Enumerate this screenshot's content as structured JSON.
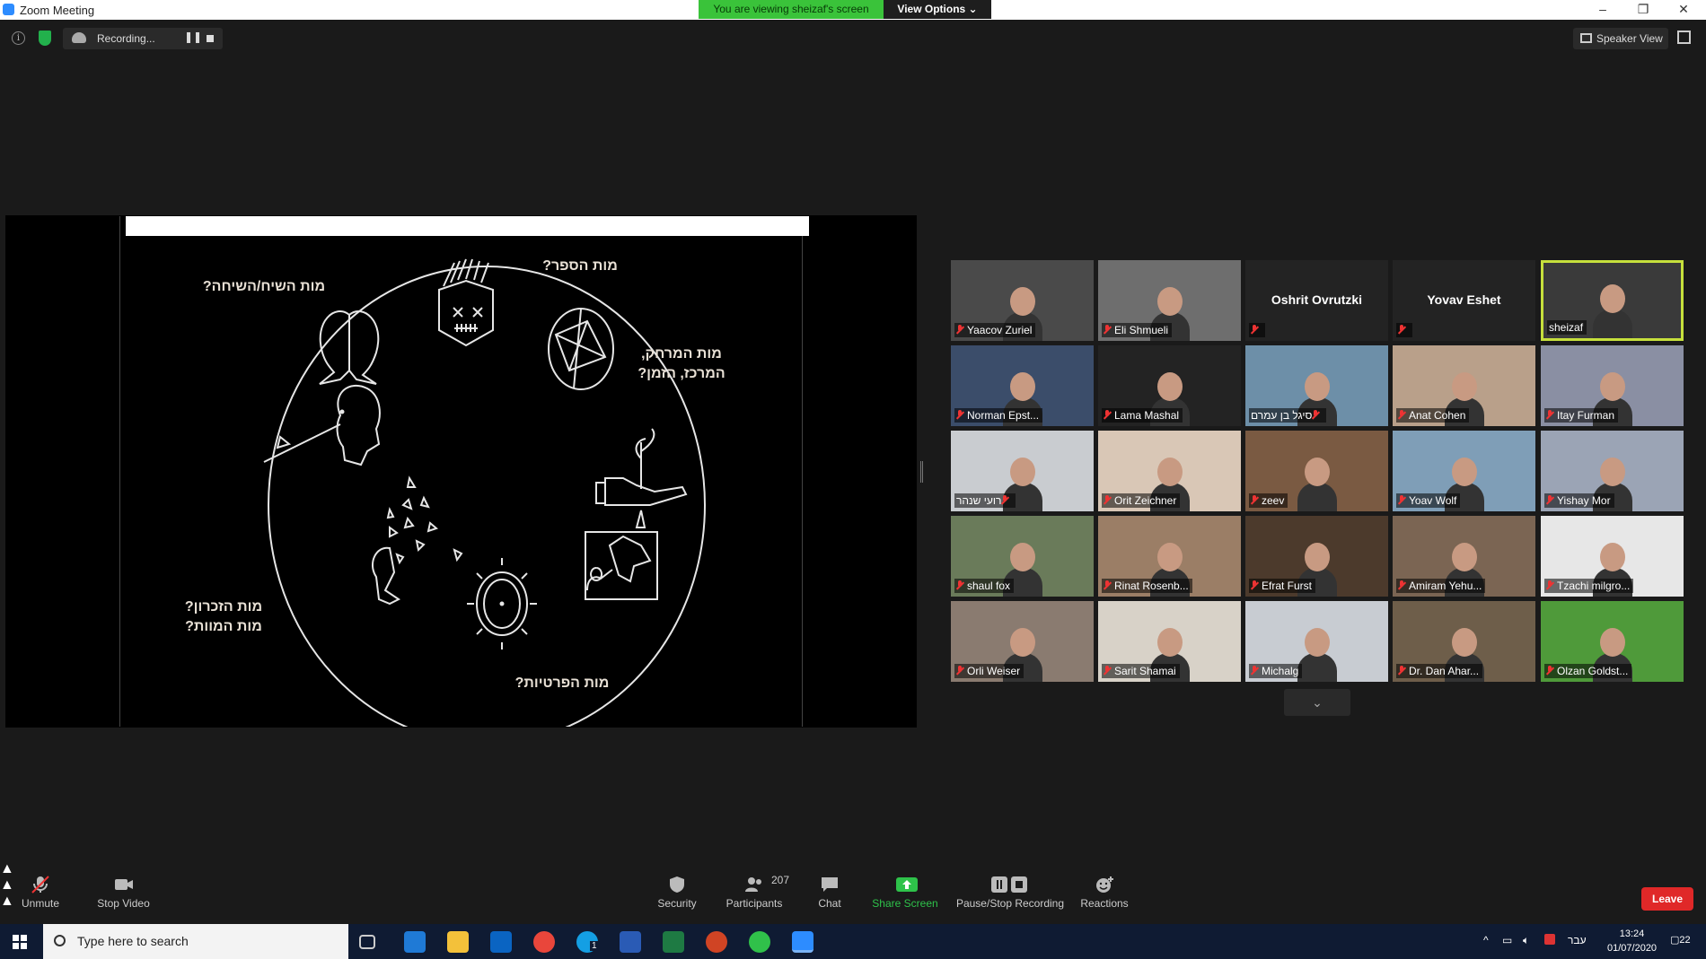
{
  "window": {
    "title": "Zoom Meeting",
    "viewing_banner": "You are viewing sheizaf's screen",
    "view_options": "View Options ⌄"
  },
  "recording": {
    "label": "Recording..."
  },
  "view_mode": "Speaker View",
  "slide": {
    "labels": [
      "מות הספר?",
      "מות השיח/השיחה?",
      "מות המרחק,\nהמרכז, הזמן?",
      "מות הזכרון?\nמות המוות?",
      "מות הפרטיות?"
    ]
  },
  "participants": [
    {
      "name": "Yaacov Zuriel",
      "muted": true
    },
    {
      "name": "Eli Shmueli",
      "muted": true
    },
    {
      "name": "",
      "display_name": "Oshrit Ovrutzki",
      "muted": true
    },
    {
      "name": "",
      "display_name": "Yovav Eshet",
      "muted": true
    },
    {
      "name": "sheizaf",
      "muted": false,
      "active_speaker": true
    },
    {
      "name": "Norman Epst...",
      "muted": true
    },
    {
      "name": "Lama Mashal",
      "muted": true
    },
    {
      "name": "סיגל בן עמרם",
      "muted": true
    },
    {
      "name": "Anat Cohen",
      "muted": true
    },
    {
      "name": "Itay Furman",
      "muted": true
    },
    {
      "name": "רועי שנהר",
      "muted": true
    },
    {
      "name": "Orit Zeichner",
      "muted": true
    },
    {
      "name": "zeev",
      "muted": true
    },
    {
      "name": "Yoav Wolf",
      "muted": true
    },
    {
      "name": "Yishay Mor",
      "muted": true
    },
    {
      "name": "shaul fox",
      "muted": true
    },
    {
      "name": "Rinat Rosenb...",
      "muted": true
    },
    {
      "name": "Efrat Furst",
      "muted": true
    },
    {
      "name": "Amiram Yehu...",
      "muted": true
    },
    {
      "name": "Tzachi milgro...",
      "muted": true
    },
    {
      "name": "Orli Weiser",
      "muted": true
    },
    {
      "name": "Sarit Shamai",
      "muted": true
    },
    {
      "name": "Michalg",
      "muted": true
    },
    {
      "name": "Dr. Dan Ahar...",
      "muted": true
    },
    {
      "name": "Olzan Goldst...",
      "muted": true
    }
  ],
  "toolbar": {
    "unmute": "Unmute",
    "stop_video": "Stop Video",
    "security": "Security",
    "participants": "Participants",
    "participants_count": "207",
    "chat": "Chat",
    "share_screen": "Share Screen",
    "pause_stop_recording": "Pause/Stop Recording",
    "reactions": "Reactions",
    "leave": "Leave"
  },
  "taskbar": {
    "search_placeholder": "Type here to search",
    "language": "עבר",
    "time": "13:24",
    "date": "01/07/2020",
    "notifications": "22",
    "skype_badge": "1"
  },
  "colors": {
    "banner_green": "#3ac33a",
    "leave_red": "#e02828",
    "active_speaker_border": "#c6e03c",
    "taskbar": "#0f1b33"
  }
}
